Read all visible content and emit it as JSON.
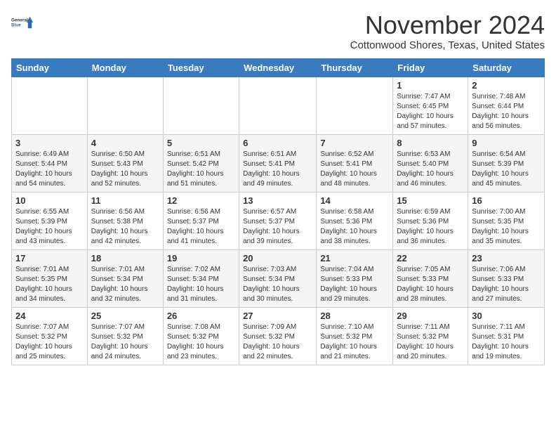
{
  "header": {
    "logo_line1": "General",
    "logo_line2": "Blue",
    "month_title": "November 2024",
    "subtitle": "Cottonwood Shores, Texas, United States"
  },
  "days_of_week": [
    "Sunday",
    "Monday",
    "Tuesday",
    "Wednesday",
    "Thursday",
    "Friday",
    "Saturday"
  ],
  "weeks": [
    [
      {
        "day": "",
        "info": ""
      },
      {
        "day": "",
        "info": ""
      },
      {
        "day": "",
        "info": ""
      },
      {
        "day": "",
        "info": ""
      },
      {
        "day": "",
        "info": ""
      },
      {
        "day": "1",
        "info": "Sunrise: 7:47 AM\nSunset: 6:45 PM\nDaylight: 10 hours and 57 minutes."
      },
      {
        "day": "2",
        "info": "Sunrise: 7:48 AM\nSunset: 6:44 PM\nDaylight: 10 hours and 56 minutes."
      }
    ],
    [
      {
        "day": "3",
        "info": "Sunrise: 6:49 AM\nSunset: 5:44 PM\nDaylight: 10 hours and 54 minutes."
      },
      {
        "day": "4",
        "info": "Sunrise: 6:50 AM\nSunset: 5:43 PM\nDaylight: 10 hours and 52 minutes."
      },
      {
        "day": "5",
        "info": "Sunrise: 6:51 AM\nSunset: 5:42 PM\nDaylight: 10 hours and 51 minutes."
      },
      {
        "day": "6",
        "info": "Sunrise: 6:51 AM\nSunset: 5:41 PM\nDaylight: 10 hours and 49 minutes."
      },
      {
        "day": "7",
        "info": "Sunrise: 6:52 AM\nSunset: 5:41 PM\nDaylight: 10 hours and 48 minutes."
      },
      {
        "day": "8",
        "info": "Sunrise: 6:53 AM\nSunset: 5:40 PM\nDaylight: 10 hours and 46 minutes."
      },
      {
        "day": "9",
        "info": "Sunrise: 6:54 AM\nSunset: 5:39 PM\nDaylight: 10 hours and 45 minutes."
      }
    ],
    [
      {
        "day": "10",
        "info": "Sunrise: 6:55 AM\nSunset: 5:39 PM\nDaylight: 10 hours and 43 minutes."
      },
      {
        "day": "11",
        "info": "Sunrise: 6:56 AM\nSunset: 5:38 PM\nDaylight: 10 hours and 42 minutes."
      },
      {
        "day": "12",
        "info": "Sunrise: 6:56 AM\nSunset: 5:37 PM\nDaylight: 10 hours and 41 minutes."
      },
      {
        "day": "13",
        "info": "Sunrise: 6:57 AM\nSunset: 5:37 PM\nDaylight: 10 hours and 39 minutes."
      },
      {
        "day": "14",
        "info": "Sunrise: 6:58 AM\nSunset: 5:36 PM\nDaylight: 10 hours and 38 minutes."
      },
      {
        "day": "15",
        "info": "Sunrise: 6:59 AM\nSunset: 5:36 PM\nDaylight: 10 hours and 36 minutes."
      },
      {
        "day": "16",
        "info": "Sunrise: 7:00 AM\nSunset: 5:35 PM\nDaylight: 10 hours and 35 minutes."
      }
    ],
    [
      {
        "day": "17",
        "info": "Sunrise: 7:01 AM\nSunset: 5:35 PM\nDaylight: 10 hours and 34 minutes."
      },
      {
        "day": "18",
        "info": "Sunrise: 7:01 AM\nSunset: 5:34 PM\nDaylight: 10 hours and 32 minutes."
      },
      {
        "day": "19",
        "info": "Sunrise: 7:02 AM\nSunset: 5:34 PM\nDaylight: 10 hours and 31 minutes."
      },
      {
        "day": "20",
        "info": "Sunrise: 7:03 AM\nSunset: 5:34 PM\nDaylight: 10 hours and 30 minutes."
      },
      {
        "day": "21",
        "info": "Sunrise: 7:04 AM\nSunset: 5:33 PM\nDaylight: 10 hours and 29 minutes."
      },
      {
        "day": "22",
        "info": "Sunrise: 7:05 AM\nSunset: 5:33 PM\nDaylight: 10 hours and 28 minutes."
      },
      {
        "day": "23",
        "info": "Sunrise: 7:06 AM\nSunset: 5:33 PM\nDaylight: 10 hours and 27 minutes."
      }
    ],
    [
      {
        "day": "24",
        "info": "Sunrise: 7:07 AM\nSunset: 5:32 PM\nDaylight: 10 hours and 25 minutes."
      },
      {
        "day": "25",
        "info": "Sunrise: 7:07 AM\nSunset: 5:32 PM\nDaylight: 10 hours and 24 minutes."
      },
      {
        "day": "26",
        "info": "Sunrise: 7:08 AM\nSunset: 5:32 PM\nDaylight: 10 hours and 23 minutes."
      },
      {
        "day": "27",
        "info": "Sunrise: 7:09 AM\nSunset: 5:32 PM\nDaylight: 10 hours and 22 minutes."
      },
      {
        "day": "28",
        "info": "Sunrise: 7:10 AM\nSunset: 5:32 PM\nDaylight: 10 hours and 21 minutes."
      },
      {
        "day": "29",
        "info": "Sunrise: 7:11 AM\nSunset: 5:32 PM\nDaylight: 10 hours and 20 minutes."
      },
      {
        "day": "30",
        "info": "Sunrise: 7:11 AM\nSunset: 5:31 PM\nDaylight: 10 hours and 19 minutes."
      }
    ]
  ]
}
